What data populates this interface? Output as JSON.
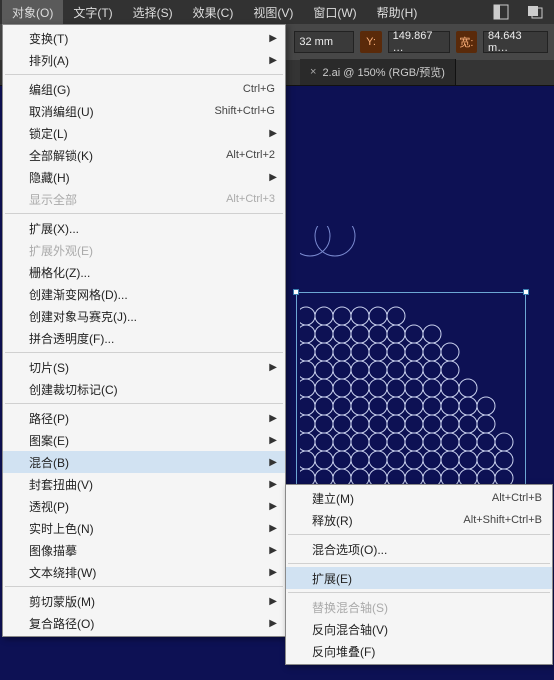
{
  "menubar": {
    "items": [
      {
        "label": "对象(O)",
        "active": true
      },
      {
        "label": "文字(T)"
      },
      {
        "label": "选择(S)"
      },
      {
        "label": "效果(C)"
      },
      {
        "label": "视图(V)"
      },
      {
        "label": "窗口(W)"
      },
      {
        "label": "帮助(H)"
      }
    ]
  },
  "toolbar": {
    "x_suffix": "32 mm",
    "y_label": "Y:",
    "y_value": "149.867 …",
    "w_label": "宽:",
    "w_value": "84.643 m…"
  },
  "tab": {
    "close": "×",
    "label": "2.ai @ 150% (RGB/预览)"
  },
  "menu": {
    "transform": "变换(T)",
    "arrange": "排列(A)",
    "group": "编组(G)",
    "group_sc": "Ctrl+G",
    "ungroup": "取消编组(U)",
    "ungroup_sc": "Shift+Ctrl+G",
    "lock": "锁定(L)",
    "unlock_all": "全部解锁(K)",
    "unlock_all_sc": "Alt+Ctrl+2",
    "hide": "隐藏(H)",
    "show_all": "显示全部",
    "show_all_sc": "Alt+Ctrl+3",
    "expand": "扩展(X)...",
    "expand_appearance": "扩展外观(E)",
    "rasterize": "栅格化(Z)...",
    "gradient_mesh": "创建渐变网格(D)...",
    "mosaic": "创建对象马赛克(J)...",
    "flatten": "拼合透明度(F)...",
    "slice": "切片(S)",
    "crop_marks": "创建裁切标记(C)",
    "path": "路径(P)",
    "pattern": "图案(E)",
    "blend": "混合(B)",
    "envelope": "封套扭曲(V)",
    "perspective": "透视(P)",
    "live_paint": "实时上色(N)",
    "image_trace": "图像描摹",
    "text_wrap": "文本绕排(W)",
    "clipping_mask": "剪切蒙版(M)",
    "compound_path": "复合路径(O)"
  },
  "submenu": {
    "make": "建立(M)",
    "make_sc": "Alt+Ctrl+B",
    "release": "释放(R)",
    "release_sc": "Alt+Shift+Ctrl+B",
    "options": "混合选项(O)...",
    "expand": "扩展(E)",
    "replace_spine": "替换混合轴(S)",
    "reverse_spine": "反向混合轴(V)",
    "reverse_front": "反向堆叠(F)"
  }
}
